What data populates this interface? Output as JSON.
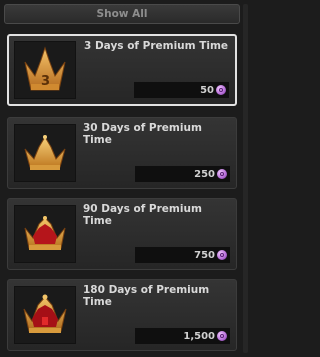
{
  "filter": {
    "label": "Show All"
  },
  "items": [
    {
      "title": "3 Days of Premium Time",
      "price": "50",
      "badge": "3",
      "icon": "crown-icon"
    },
    {
      "title": "30 Days of Premium Time",
      "price": "250",
      "icon": "crown-icon"
    },
    {
      "title": "90 Days of Premium Time",
      "price": "750",
      "icon": "jeweled-crown-icon"
    },
    {
      "title": "180 Days of Premium Time",
      "price": "1,500",
      "icon": "royal-crown-icon"
    }
  ],
  "colors": {
    "gold": "#e3a33c",
    "currency": "#b36ad6",
    "jewel": "#c01818"
  }
}
